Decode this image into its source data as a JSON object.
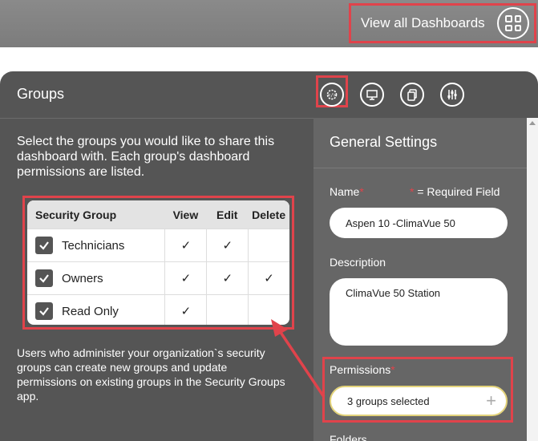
{
  "header": {
    "view_all_label": "View all Dashboards",
    "view_all_icon": "grid-icon"
  },
  "groups_panel": {
    "title": "Groups",
    "intro": "Select the groups you would like to share this dashboard with. Each group's dashboard permissions are listed.",
    "table": {
      "headers": [
        "Security Group",
        "View",
        "Edit",
        "Delete"
      ],
      "rows": [
        {
          "name": "Technicians",
          "checked": true,
          "view": "✓",
          "edit": "✓",
          "delete": ""
        },
        {
          "name": "Owners",
          "checked": true,
          "view": "✓",
          "edit": "✓",
          "delete": "✓"
        },
        {
          "name": "Read Only",
          "checked": true,
          "view": "✓",
          "edit": "",
          "delete": ""
        }
      ]
    },
    "footnote": "Users who administer your organization`s security groups can create new groups and update permissions on existing groups in the Security Groups app."
  },
  "tabs": [
    {
      "icon": "gear-code-icon",
      "selected": true
    },
    {
      "icon": "monitor-icon",
      "selected": false
    },
    {
      "icon": "copy-icon",
      "selected": false
    },
    {
      "icon": "sliders-icon",
      "selected": false
    }
  ],
  "general_settings": {
    "title": "General Settings",
    "name_label": "Name",
    "required_star": "*",
    "required_note": "= Required Field",
    "name_value": "Aspen 10 -ClimaVue 50",
    "description_label": "Description",
    "description_value": "ClimaVue 50 Station",
    "permissions_label": "Permissions",
    "permissions_value": "3 groups selected",
    "permissions_add": "+",
    "folders_label": "Folders"
  },
  "colors": {
    "highlight": "#e0434b",
    "panel": "#555555",
    "right_column": "#666666"
  }
}
